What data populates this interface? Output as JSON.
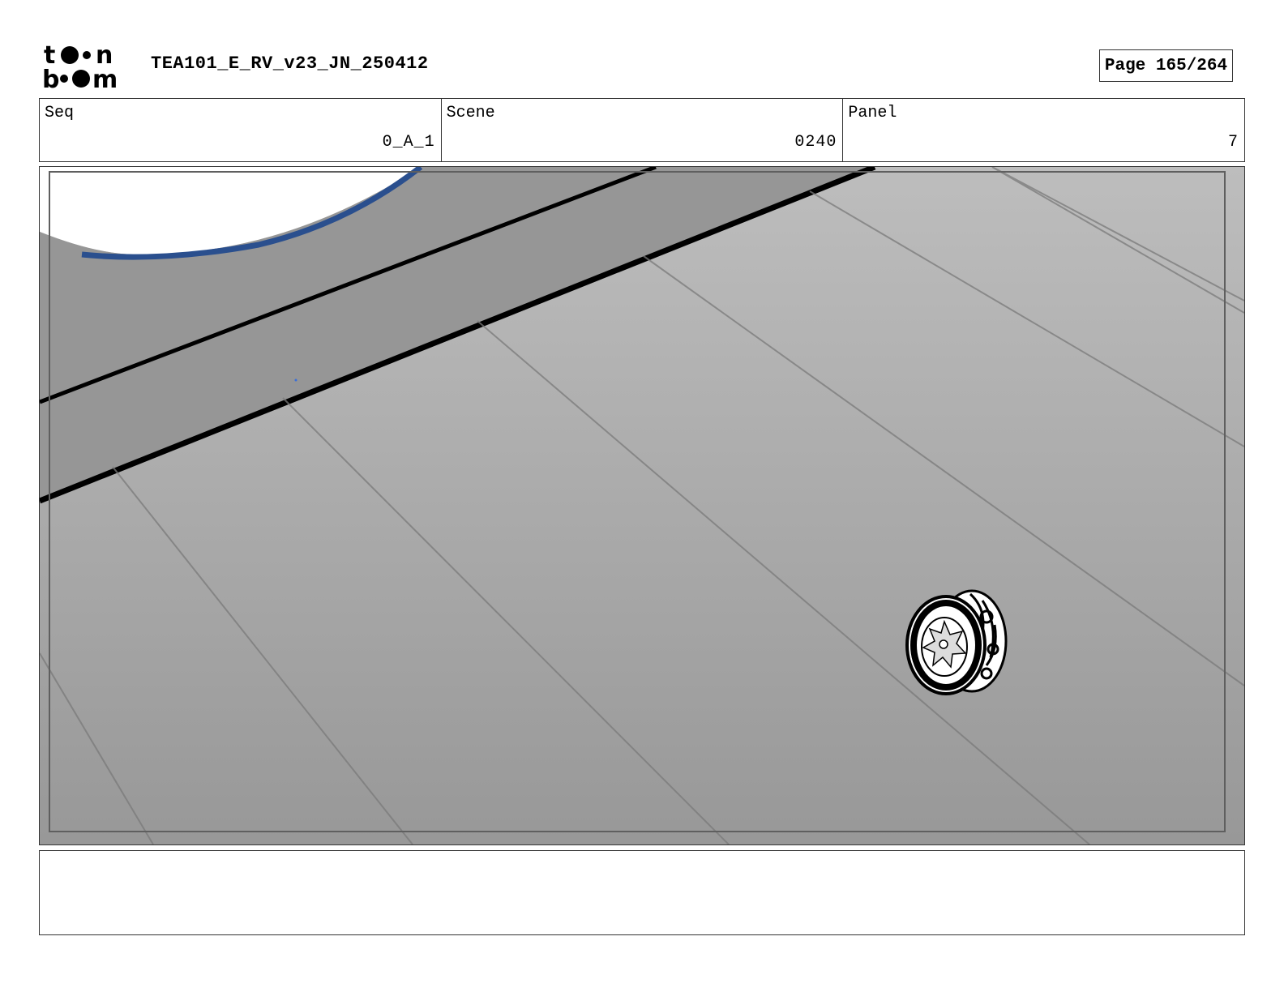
{
  "header": {
    "logo_text": "toon boom",
    "title": "TEA101_E_RV_v23_JN_250412",
    "page": "Page 165/264"
  },
  "fields": [
    {
      "label": "Seq",
      "value": "0_A_1"
    },
    {
      "label": "Scene",
      "value": "0240"
    },
    {
      "label": "Panel",
      "value": "7"
    }
  ],
  "panel": {
    "description": "",
    "colors": {
      "floor_light": "#b9b9b9",
      "floor_dark": "#9a9a9a",
      "road": "#959595",
      "edge_blue": "#2a4f8e"
    }
  },
  "dialogue": ""
}
